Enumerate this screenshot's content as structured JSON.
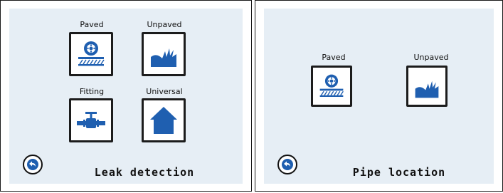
{
  "left_screen": {
    "title": "Leak detection",
    "tiles": [
      {
        "label": "Paved",
        "icon": "paved-road-wheel-icon"
      },
      {
        "label": "Unpaved",
        "icon": "unpaved-grass-icon"
      },
      {
        "label": "Fitting",
        "icon": "pipe-valve-icon"
      },
      {
        "label": "Universal",
        "icon": "house-icon"
      }
    ],
    "back_icon": "back-arrow-icon"
  },
  "right_screen": {
    "title": "Pipe location",
    "tiles": [
      {
        "label": "Paved",
        "icon": "paved-road-wheel-icon"
      },
      {
        "label": "Unpaved",
        "icon": "unpaved-grass-icon"
      }
    ],
    "back_icon": "back-arrow-icon"
  },
  "colors": {
    "icon_blue": "#1f5fb0",
    "screen_bg": "#e6eef5",
    "frame": "#1c1c1c"
  }
}
